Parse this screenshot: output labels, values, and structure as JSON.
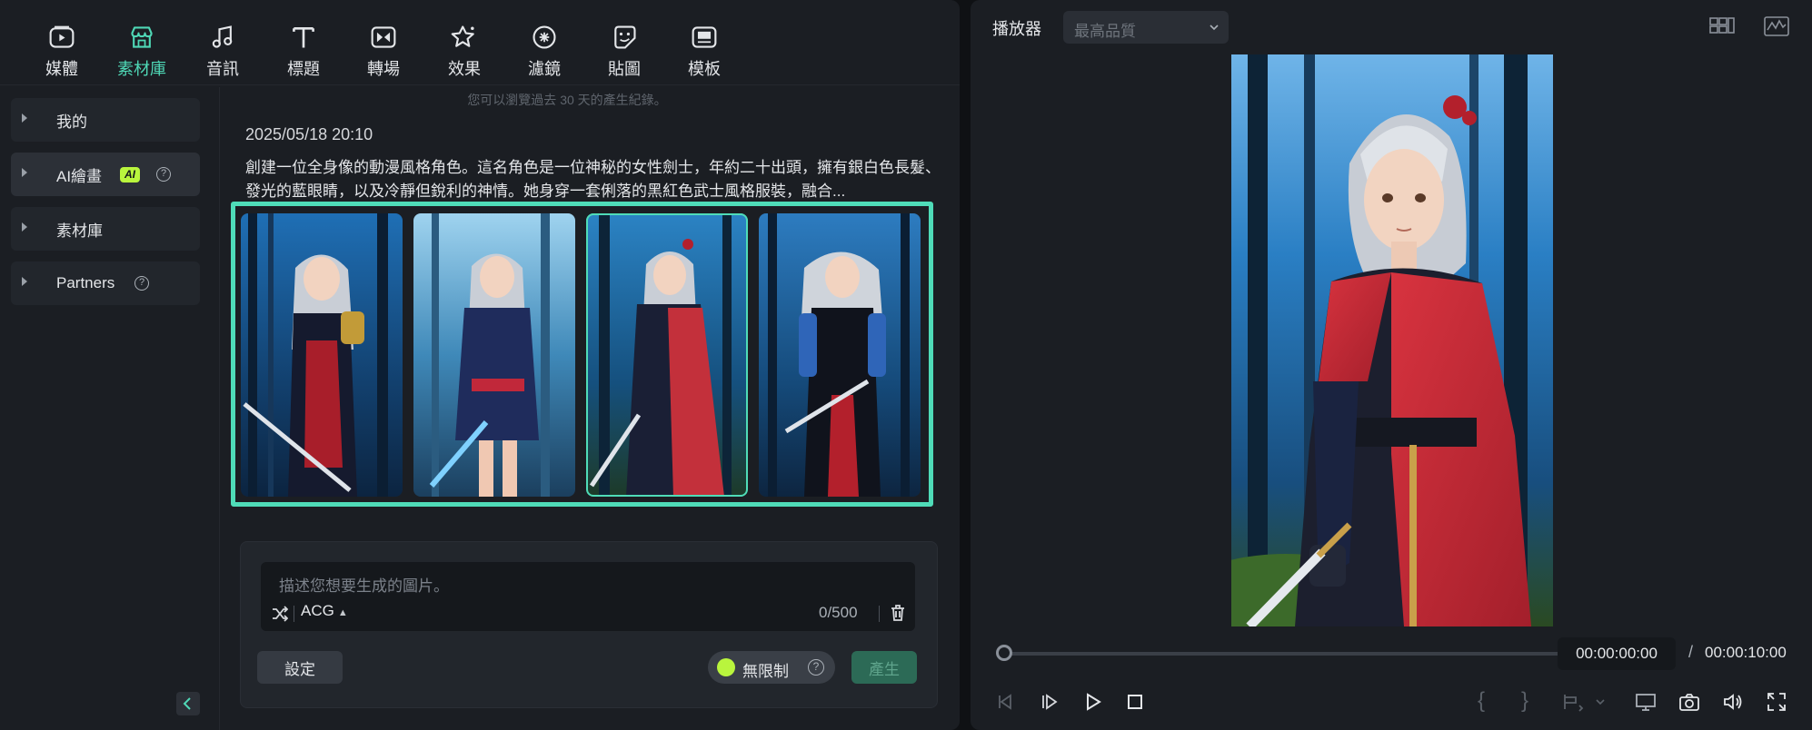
{
  "toolbar": {
    "items": [
      {
        "label": "媒體",
        "icon": "media-icon"
      },
      {
        "label": "素材庫",
        "icon": "store-icon",
        "active": true
      },
      {
        "label": "音訊",
        "icon": "music-note-icon"
      },
      {
        "label": "標題",
        "icon": "text-title-icon"
      },
      {
        "label": "轉場",
        "icon": "transition-icon"
      },
      {
        "label": "效果",
        "icon": "effects-icon"
      },
      {
        "label": "濾鏡",
        "icon": "filter-icon"
      },
      {
        "label": "貼圖",
        "icon": "sticker-icon"
      },
      {
        "label": "模板",
        "icon": "template-icon"
      }
    ],
    "accent_color": "#4fd8b6"
  },
  "sidebar": {
    "items": [
      {
        "label": "我的"
      },
      {
        "label": "AI繪畫",
        "badge": "AI",
        "selected": true
      },
      {
        "label": "素材庫"
      },
      {
        "label": "Partners"
      }
    ]
  },
  "main": {
    "history_note": "您可以瀏覽過去 30 天的產生紀錄。",
    "date": "2025/05/18 20:10",
    "prompt_text": "創建一位全身像的動漫風格角色。這名角色是一位神秘的女性劍士，年約二十出頭，擁有銀白色長髮、發光的藍眼睛，以及冷靜但銳利的神情。她身穿一套俐落的黑紅色武士風格服裝，融合...",
    "selected_image_index": 2,
    "grid_border_color": "#4fdcb8"
  },
  "prompt_box": {
    "placeholder": "描述您想要生成的圖片。",
    "style": "ACG",
    "char_count": "0/500",
    "settings_label": "設定",
    "unlimited_label": "無限制",
    "generate_label": "產生"
  },
  "player": {
    "title": "播放器",
    "quality": "最高品質",
    "current_time": "00:00:00:00",
    "separator": "/",
    "total_time": "00:00:10:00",
    "progress": 0
  }
}
